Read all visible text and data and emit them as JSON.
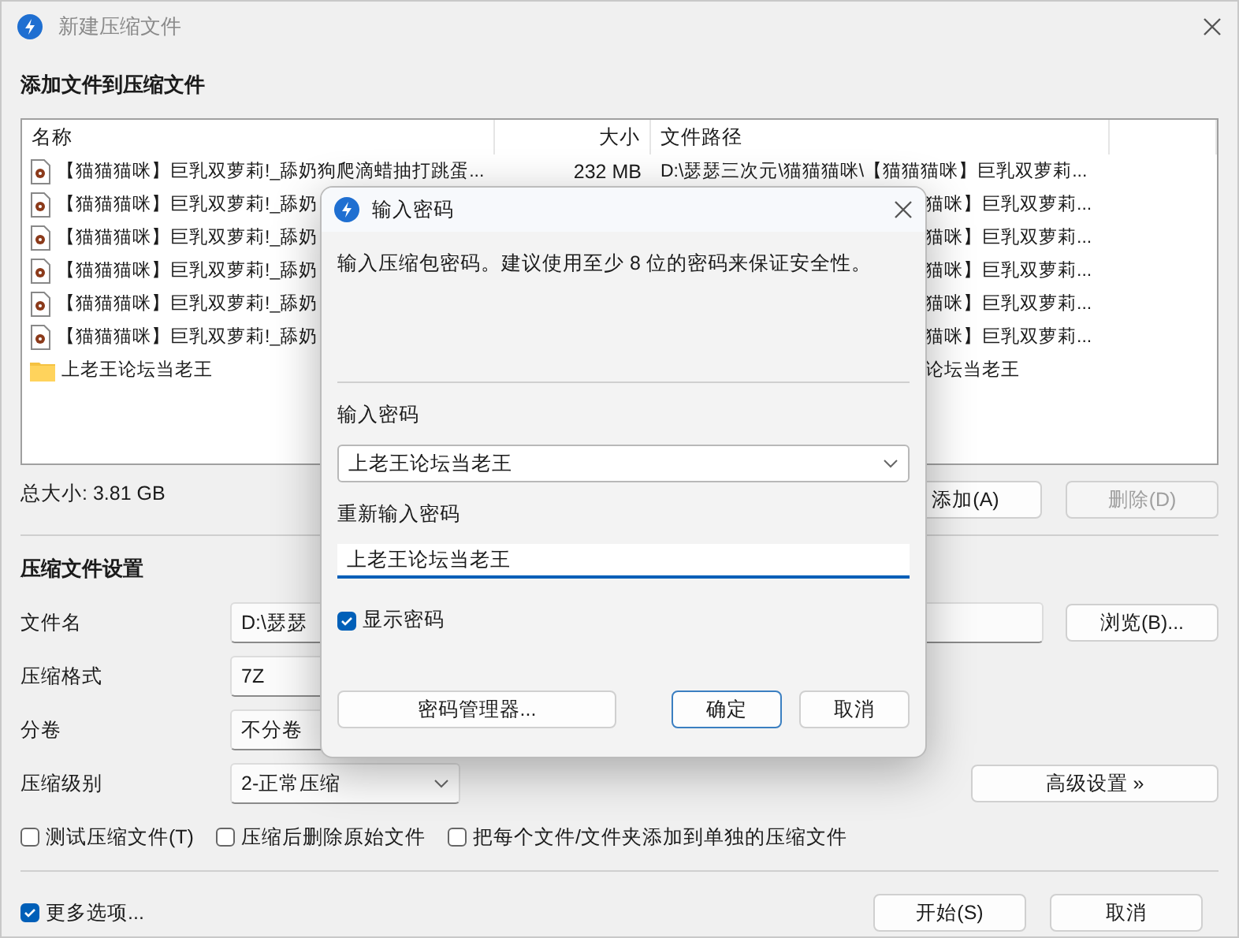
{
  "window": {
    "title": "新建压缩文件"
  },
  "files_heading": "添加文件到压缩文件",
  "file_list": {
    "columns": [
      "名称",
      "大小",
      "文件路径"
    ],
    "rows": [
      {
        "kind": "video",
        "covered": false,
        "name": "【猫猫猫咪】巨乳双萝莉!_舔奶狗爬滴蜡抽打跳蛋...",
        "size": "232 MB",
        "path": "D:\\瑟瑟三次元\\猫猫猫咪\\【猫猫猫咪】巨乳双萝莉..."
      },
      {
        "kind": "video",
        "covered": true,
        "name": "【猫猫猫咪】巨乳双萝莉!_舔奶",
        "path": "猫咪】巨乳双萝莉..."
      },
      {
        "kind": "video",
        "covered": true,
        "name": "【猫猫猫咪】巨乳双萝莉!_舔奶",
        "path": "猫咪】巨乳双萝莉..."
      },
      {
        "kind": "video",
        "covered": true,
        "name": "【猫猫猫咪】巨乳双萝莉!_舔奶",
        "path": "猫咪】巨乳双萝莉..."
      },
      {
        "kind": "video",
        "covered": true,
        "name": "【猫猫猫咪】巨乳双萝莉!_舔奶",
        "path": "猫咪】巨乳双萝莉..."
      },
      {
        "kind": "video",
        "covered": true,
        "name": "【猫猫猫咪】巨乳双萝莉!_舔奶",
        "path": "猫咪】巨乳双萝莉..."
      },
      {
        "kind": "folder",
        "covered": true,
        "name": "上老王论坛当老王",
        "path": "论坛当老王"
      }
    ]
  },
  "total_size": "总大小: 3.81 GB",
  "add_button": {
    "label": "添加(A)",
    "disabled": false
  },
  "delete_button": {
    "label": "删除(D)",
    "disabled": true
  },
  "settings_heading": "压缩文件设置",
  "settings": [
    {
      "kind": "field",
      "label": "文件名",
      "value": "D:\\瑟瑟"
    },
    {
      "kind": "select",
      "label": "压缩格式",
      "value": "7Z"
    },
    {
      "kind": "select",
      "label": "分卷",
      "value": "不分卷"
    },
    {
      "kind": "dropdown",
      "label": "压缩级别",
      "value": "2-正常压缩"
    }
  ],
  "browse_button": "浏览(B)...",
  "advanced_button": "高级设置 »",
  "options": [
    {
      "label": "测试压缩文件(T)",
      "checked": false
    },
    {
      "label": "压缩后删除原始文件",
      "checked": false
    },
    {
      "label": "把每个文件/文件夹添加到单独的压缩文件",
      "checked": false
    }
  ],
  "more_options": {
    "label": "更多选项...",
    "checked": true
  },
  "footer_buttons": [
    "开始(S)",
    "取消"
  ],
  "dialog": {
    "title": "输入密码",
    "description": "输入压缩包密码。建议使用至少 8 位的密码来保证安全性。",
    "password_label": "输入密码",
    "password": "上老王论坛当老王",
    "confirm_label": "重新输入密码",
    "confirm": "上老王论坛当老王",
    "show_password": {
      "label": "显示密码",
      "checked": true
    },
    "manager_button": "密码管理器...",
    "buttons": [
      {
        "label": "确定",
        "default": true
      },
      {
        "label": "取消",
        "default": false
      }
    ]
  }
}
